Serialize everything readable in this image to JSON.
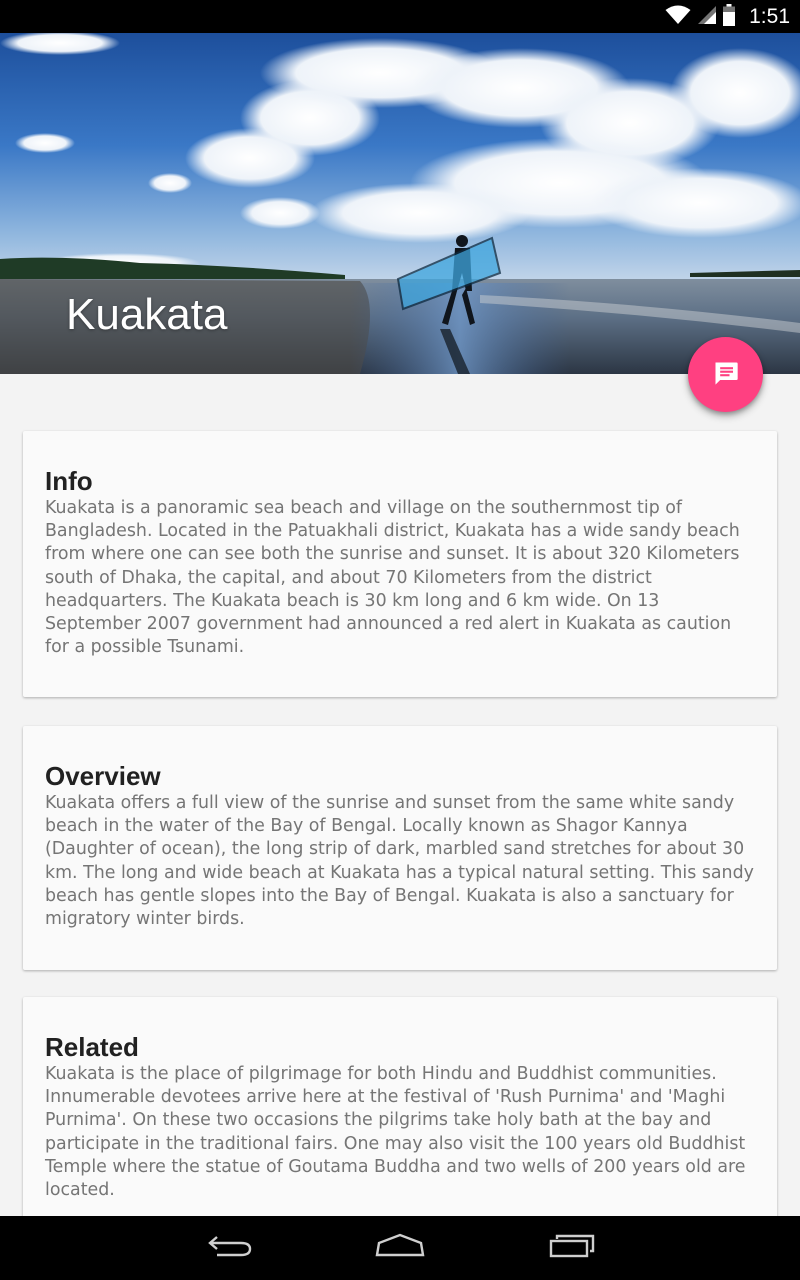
{
  "status_bar": {
    "time": "1:51",
    "icons": [
      "wifi-icon",
      "cell-signal-icon",
      "battery-icon"
    ]
  },
  "header": {
    "title": "Kuakata"
  },
  "fab": {
    "icon": "message-icon",
    "color": "#ff4081"
  },
  "cards": [
    {
      "title": "Info",
      "body": "Kuakata is a panoramic sea beach and village on the southernmost tip of Bangladesh. Located in the Patuakhali district, Kuakata has a wide sandy beach from where one can see both the sunrise and sunset. It is about 320 Kilometers south of Dhaka, the capital, and about 70 Kilometers from the district headquarters. The Kuakata beach is 30 km long and 6 km wide. On 13 September 2007 government had announced a red alert in Kuakata as caution for a possible Tsunami."
    },
    {
      "title": "Overview",
      "body": "Kuakata offers a full view of the sunrise and sunset from the same white sandy beach in the water of the Bay of Bengal. Locally known as Shagor Kannya (Daughter of ocean), the long strip of dark, marbled sand stretches for about 30 km. The long and wide beach at Kuakata has a typical natural setting. This sandy beach has gentle slopes into the Bay of Bengal. Kuakata is also a sanctuary for migratory winter birds."
    },
    {
      "title": "Related",
      "body": "Kuakata is the place of pilgrimage for both Hindu and Buddhist communities. Innumerable devotees arrive here at the festival of 'Rush Purnima' and 'Maghi Purnima'. On these two occasions the pilgrims take holy bath at the bay and participate in the traditional fairs. One may also visit the 100 years old Buddhist Temple where the statue of Goutama Buddha and two wells of 200 years old are located."
    }
  ],
  "nav_bar": {
    "buttons": [
      "back-icon",
      "home-icon",
      "recents-icon"
    ]
  }
}
